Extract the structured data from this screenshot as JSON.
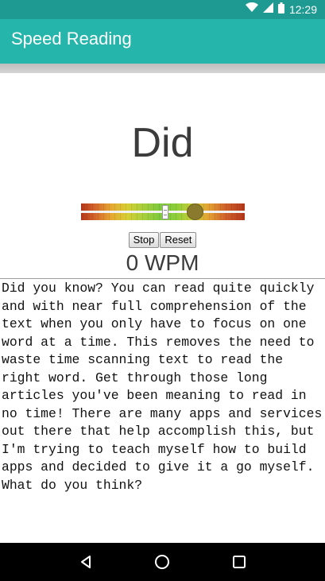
{
  "status_bar": {
    "time": "12:29",
    "icons": [
      "wifi-icon",
      "signal-icon",
      "battery-icon"
    ]
  },
  "app_bar": {
    "title": "Speed Reading"
  },
  "reader": {
    "current_word": "Did",
    "speed_slider_level": 0.72,
    "buttons": {
      "stop": "Stop",
      "reset": "Reset"
    },
    "wpm": "0 WPM"
  },
  "text_area": {
    "content": "Did you know? You can read quite quickly and with near full comprehension of the text when you only have to focus on one word at a time. This removes the need to waste time scanning text to read the right word. Get through those long articles you've been meaning to read in no time! There are many apps and services out there that help accomplish this, but I'm trying to teach myself how to build apps and decided to give it a go myself. What do you think?"
  },
  "nav_bar": {
    "icons": [
      "back-icon",
      "home-icon",
      "recents-icon"
    ]
  },
  "colors": {
    "app_bar": "#26b5aa",
    "status_bar": "#1e9a92",
    "nav_bar": "#000000"
  }
}
